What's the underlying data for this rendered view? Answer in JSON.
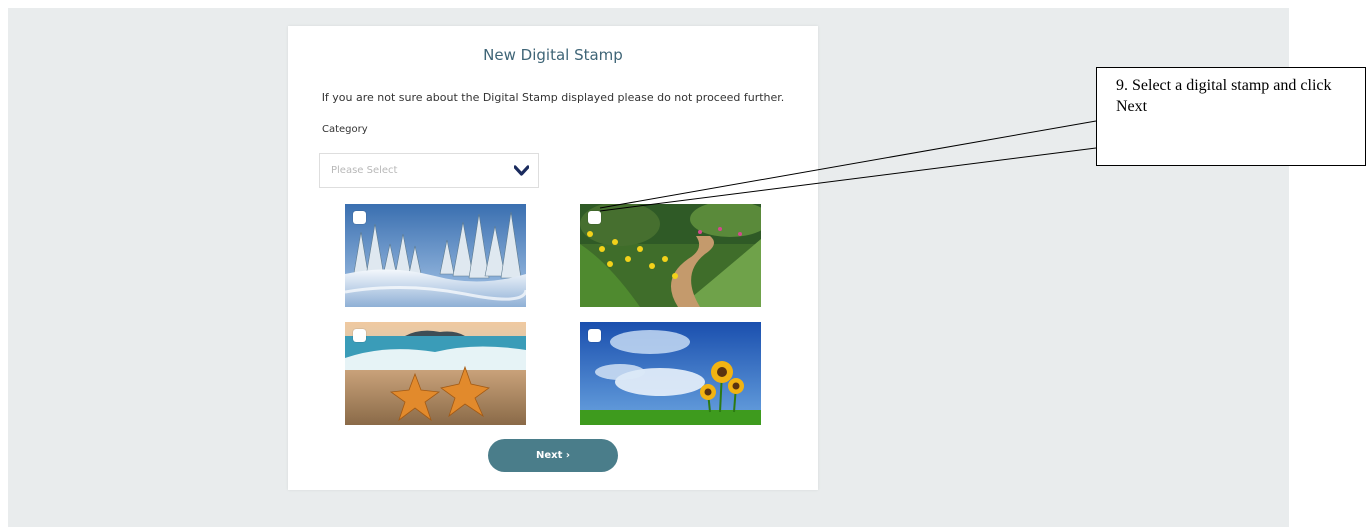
{
  "dialog": {
    "title": "New Digital Stamp",
    "notice": "If you are not sure about the Digital Stamp displayed please do not proceed further.",
    "category_label": "Category",
    "category_placeholder": "Please Select",
    "next_label": "Next ›"
  },
  "stamps": [
    {
      "name": "winter-forest",
      "checked": false
    },
    {
      "name": "garden-path",
      "checked": false
    },
    {
      "name": "starfish-beach",
      "checked": false
    },
    {
      "name": "sunflowers-sky",
      "checked": false
    }
  ],
  "callout": {
    "text": "9. Select a digital stamp and click Next"
  },
  "colors": {
    "background": "#e9eced",
    "accent": "#4a7d8a",
    "title": "#3f6577"
  }
}
